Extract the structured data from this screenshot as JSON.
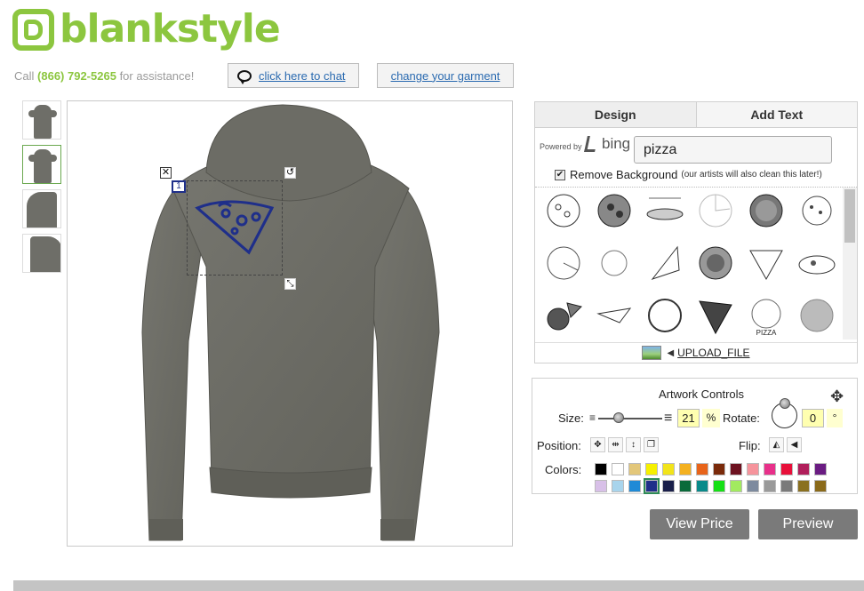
{
  "brand": {
    "name": "blankstyle"
  },
  "header": {
    "assist_prefix": "Call",
    "phone": "(866) 792-5265",
    "assist_suffix": "for assistance!",
    "chat_label": "click here to chat",
    "garment_label": "change your garment"
  },
  "designer": {
    "selection_number": "1",
    "close_glyph": "✕",
    "rotate_glyph": "↺",
    "resize_glyph": "⤡"
  },
  "panel": {
    "tabs": [
      {
        "label": "Design"
      },
      {
        "label": "Add Text"
      }
    ],
    "powered_by": "Powered by",
    "bing_label": "bing",
    "search_value": "pizza",
    "remove_bg_label": "Remove Background",
    "remove_bg_note": "(our artists will also clean this later!)",
    "upload_label": "UPLOAD_FILE"
  },
  "artwork": {
    "title": "Artwork Controls",
    "size_label": "Size:",
    "size_value": "21",
    "size_unit": "%",
    "rotate_label": "Rotate:",
    "rotate_value": "0",
    "rotate_unit": "°",
    "position_label": "Position:",
    "flip_label": "Flip:",
    "colors_label": "Colors:",
    "colors_row1": [
      "#000000",
      "#ffffff",
      "#e3c77a",
      "#f6f000",
      "#f2e41a",
      "#f4b120",
      "#e8641a",
      "#7a2a0a",
      "#6d1220",
      "#f6949c",
      "#e8308a",
      "#e8103a",
      "#b01e5a",
      "#6a1c82"
    ],
    "colors_row2": [
      "#d8c0e8",
      "#a8d4ec",
      "#1f8ad6",
      "#1f2f8a",
      "#1a1f4a",
      "#0a6a3a",
      "#0a8a8a",
      "#16e016",
      "#a2ea60",
      "#7d8a9e",
      "#9a9a9a",
      "#7a7a7a",
      "#8a7020",
      "#8a6a1a"
    ],
    "selected_color": "#1f2f8a"
  },
  "actions": {
    "view_price": "View Price",
    "preview": "Preview"
  }
}
